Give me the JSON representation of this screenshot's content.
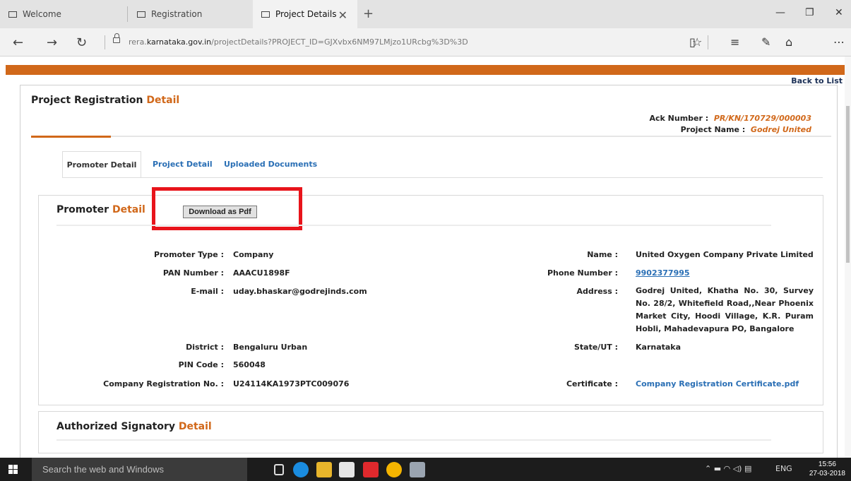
{
  "browser": {
    "tabs": [
      {
        "label": "Welcome"
      },
      {
        "label": "Registration"
      },
      {
        "label": "Project Details"
      }
    ],
    "url_prefix": "rera.",
    "url_domain": "karnataka.gov.in",
    "url_path": "/projectDetails?PROJECT_ID=GJXvbx6NM97LMjzo1URcbg%3D%3D"
  },
  "page": {
    "back_to_list": "Back to List",
    "heading_main": "Project Registration",
    "heading_accent": "Detail",
    "ack_label": "Ack Number :",
    "ack_value": "PR/KN/170729/000003",
    "project_name_label": "Project Name :",
    "project_name_value": "Godrej United",
    "tabs": [
      "Promoter Detail",
      "Project Detail",
      "Uploaded Documents"
    ]
  },
  "promoter": {
    "title_main": "Promoter",
    "title_accent": "Detail",
    "download_label": "Download as Pdf",
    "left": [
      {
        "label": "Promoter Type :",
        "value": "Company"
      },
      {
        "label": "PAN Number :",
        "value": "AAACU1898F"
      },
      {
        "label": "E-mail :",
        "value": "uday.bhaskar@godrejinds.com"
      },
      {
        "label": "District :",
        "value": "Bengaluru Urban"
      },
      {
        "label": "PIN Code :",
        "value": "560048"
      },
      {
        "label": "Company Registration No. :",
        "value": "U24114KA1973PTC009076"
      }
    ],
    "right": [
      {
        "label": "Name :",
        "value": "United Oxygen Company Private Limited"
      },
      {
        "label": "Phone Number :",
        "value": "9902377995"
      },
      {
        "label": "Address :",
        "value": "Godrej United, Khatha No. 30, Survey No. 28/2, Whitefield Road,,Near Phoenix Market City, Hoodi Village, K.R. Puram Hobli, Mahadevapura PO, Bangalore"
      },
      {
        "label": "State/UT :",
        "value": "Karnataka"
      },
      {
        "label": "Certificate :",
        "value": "Company Registration Certificate.pdf"
      }
    ]
  },
  "signatory": {
    "title_main": "Authorized Signatory",
    "title_accent": "Detail"
  },
  "taskbar": {
    "search_placeholder": "Search the web and Windows",
    "lang": "ENG",
    "time": "15:56",
    "date": "27-03-2018"
  },
  "colors": {
    "accent_orange": "#d1681a",
    "link_blue": "#2a6fb5",
    "highlight_red": "#e8141b"
  }
}
